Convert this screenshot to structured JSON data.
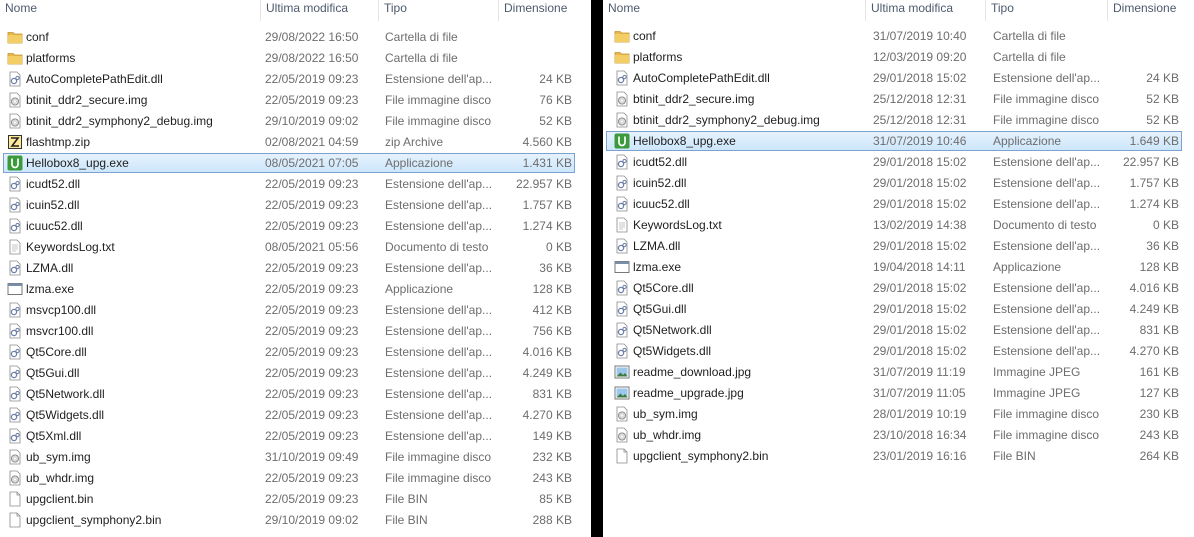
{
  "columns": {
    "name": "Nome",
    "modified": "Ultima modifica",
    "type": "Tipo",
    "size": "Dimensione"
  },
  "left_pane": {
    "files": [
      {
        "name": "conf",
        "modified": "29/08/2022 16:50",
        "type": "Cartella di file",
        "size": "",
        "icon": "folder-icon"
      },
      {
        "name": "platforms",
        "modified": "29/08/2022 16:50",
        "type": "Cartella di file",
        "size": "",
        "icon": "folder-icon"
      },
      {
        "name": "AutoCompletePathEdit.dll",
        "modified": "22/05/2019 09:23",
        "type": "Estensione dell'ap...",
        "size": "24 KB",
        "icon": "dll-icon"
      },
      {
        "name": "btinit_ddr2_secure.img",
        "modified": "22/05/2019 09:23",
        "type": "File immagine disco",
        "size": "76 KB",
        "icon": "disk-image-icon"
      },
      {
        "name": "btinit_ddr2_symphony2_debug.img",
        "modified": "29/10/2019 09:02",
        "type": "File immagine disco",
        "size": "52 KB",
        "icon": "disk-image-icon"
      },
      {
        "name": "flashtmp.zip",
        "modified": "02/08/2021 04:59",
        "type": "zip Archive",
        "size": "4.560 KB",
        "icon": "zip-icon"
      },
      {
        "name": "Hellobox8_upg.exe",
        "modified": "08/05/2021 07:05",
        "type": "Applicazione",
        "size": "1.431 KB",
        "icon": "hellobox-app-icon",
        "selected": true
      },
      {
        "name": "icudt52.dll",
        "modified": "22/05/2019 09:23",
        "type": "Estensione dell'ap...",
        "size": "22.957 KB",
        "icon": "dll-icon"
      },
      {
        "name": "icuin52.dll",
        "modified": "22/05/2019 09:23",
        "type": "Estensione dell'ap...",
        "size": "1.757 KB",
        "icon": "dll-icon"
      },
      {
        "name": "icuuc52.dll",
        "modified": "22/05/2019 09:23",
        "type": "Estensione dell'ap...",
        "size": "1.274 KB",
        "icon": "dll-icon"
      },
      {
        "name": "KeywordsLog.txt",
        "modified": "08/05/2021 05:56",
        "type": "Documento di testo",
        "size": "0 KB",
        "icon": "text-file-icon"
      },
      {
        "name": "LZMA.dll",
        "modified": "22/05/2019 09:23",
        "type": "Estensione dell'ap...",
        "size": "36 KB",
        "icon": "dll-icon"
      },
      {
        "name": "lzma.exe",
        "modified": "22/05/2019 09:23",
        "type": "Applicazione",
        "size": "128 KB",
        "icon": "exe-icon"
      },
      {
        "name": "msvcp100.dll",
        "modified": "22/05/2019 09:23",
        "type": "Estensione dell'ap...",
        "size": "412 KB",
        "icon": "dll-icon"
      },
      {
        "name": "msvcr100.dll",
        "modified": "22/05/2019 09:23",
        "type": "Estensione dell'ap...",
        "size": "756 KB",
        "icon": "dll-icon"
      },
      {
        "name": "Qt5Core.dll",
        "modified": "22/05/2019 09:23",
        "type": "Estensione dell'ap...",
        "size": "4.016 KB",
        "icon": "dll-icon"
      },
      {
        "name": "Qt5Gui.dll",
        "modified": "22/05/2019 09:23",
        "type": "Estensione dell'ap...",
        "size": "4.249 KB",
        "icon": "dll-icon"
      },
      {
        "name": "Qt5Network.dll",
        "modified": "22/05/2019 09:23",
        "type": "Estensione dell'ap...",
        "size": "831 KB",
        "icon": "dll-icon"
      },
      {
        "name": "Qt5Widgets.dll",
        "modified": "22/05/2019 09:23",
        "type": "Estensione dell'ap...",
        "size": "4.270 KB",
        "icon": "dll-icon"
      },
      {
        "name": "Qt5Xml.dll",
        "modified": "22/05/2019 09:23",
        "type": "Estensione dell'ap...",
        "size": "149 KB",
        "icon": "dll-icon"
      },
      {
        "name": "ub_sym.img",
        "modified": "31/10/2019 09:49",
        "type": "File immagine disco",
        "size": "232 KB",
        "icon": "disk-image-icon"
      },
      {
        "name": "ub_whdr.img",
        "modified": "22/05/2019 09:23",
        "type": "File immagine disco",
        "size": "243 KB",
        "icon": "disk-image-icon"
      },
      {
        "name": "upgclient.bin",
        "modified": "22/05/2019 09:23",
        "type": "File BIN",
        "size": "85 KB",
        "icon": "blank-file-icon"
      },
      {
        "name": "upgclient_symphony2.bin",
        "modified": "29/10/2019 09:02",
        "type": "File BIN",
        "size": "288 KB",
        "icon": "blank-file-icon"
      }
    ]
  },
  "right_pane": {
    "files": [
      {
        "name": "conf",
        "modified": "31/07/2019 10:40",
        "type": "Cartella di file",
        "size": "",
        "icon": "folder-icon"
      },
      {
        "name": "platforms",
        "modified": "12/03/2019 09:20",
        "type": "Cartella di file",
        "size": "",
        "icon": "folder-icon"
      },
      {
        "name": "AutoCompletePathEdit.dll",
        "modified": "29/01/2018 15:02",
        "type": "Estensione dell'ap...",
        "size": "24 KB",
        "icon": "dll-icon"
      },
      {
        "name": "btinit_ddr2_secure.img",
        "modified": "25/12/2018 12:31",
        "type": "File immagine disco",
        "size": "52 KB",
        "icon": "disk-image-icon"
      },
      {
        "name": "btinit_ddr2_symphony2_debug.img",
        "modified": "25/12/2018 12:31",
        "type": "File immagine disco",
        "size": "52 KB",
        "icon": "disk-image-icon"
      },
      {
        "name": "Hellobox8_upg.exe",
        "modified": "31/07/2019 10:46",
        "type": "Applicazione",
        "size": "1.649 KB",
        "icon": "hellobox-app-icon",
        "selected": true
      },
      {
        "name": "icudt52.dll",
        "modified": "29/01/2018 15:02",
        "type": "Estensione dell'ap...",
        "size": "22.957 KB",
        "icon": "dll-icon"
      },
      {
        "name": "icuin52.dll",
        "modified": "29/01/2018 15:02",
        "type": "Estensione dell'ap...",
        "size": "1.757 KB",
        "icon": "dll-icon"
      },
      {
        "name": "icuuc52.dll",
        "modified": "29/01/2018 15:02",
        "type": "Estensione dell'ap...",
        "size": "1.274 KB",
        "icon": "dll-icon"
      },
      {
        "name": "KeywordsLog.txt",
        "modified": "13/02/2019 14:38",
        "type": "Documento di testo",
        "size": "0 KB",
        "icon": "text-file-icon"
      },
      {
        "name": "LZMA.dll",
        "modified": "29/01/2018 15:02",
        "type": "Estensione dell'ap...",
        "size": "36 KB",
        "icon": "dll-icon"
      },
      {
        "name": "lzma.exe",
        "modified": "19/04/2018 14:11",
        "type": "Applicazione",
        "size": "128 KB",
        "icon": "exe-icon"
      },
      {
        "name": "Qt5Core.dll",
        "modified": "29/01/2018 15:02",
        "type": "Estensione dell'ap...",
        "size": "4.016 KB",
        "icon": "dll-icon"
      },
      {
        "name": "Qt5Gui.dll",
        "modified": "29/01/2018 15:02",
        "type": "Estensione dell'ap...",
        "size": "4.249 KB",
        "icon": "dll-icon"
      },
      {
        "name": "Qt5Network.dll",
        "modified": "29/01/2018 15:02",
        "type": "Estensione dell'ap...",
        "size": "831 KB",
        "icon": "dll-icon"
      },
      {
        "name": "Qt5Widgets.dll",
        "modified": "29/01/2018 15:02",
        "type": "Estensione dell'ap...",
        "size": "4.270 KB",
        "icon": "dll-icon"
      },
      {
        "name": "readme_download.jpg",
        "modified": "31/07/2019 11:19",
        "type": "Immagine JPEG",
        "size": "161 KB",
        "icon": "jpeg-image-icon"
      },
      {
        "name": "readme_upgrade.jpg",
        "modified": "31/07/2019 11:05",
        "type": "Immagine JPEG",
        "size": "127 KB",
        "icon": "jpeg-image-icon"
      },
      {
        "name": "ub_sym.img",
        "modified": "28/01/2019 10:19",
        "type": "File immagine disco",
        "size": "230 KB",
        "icon": "disk-image-icon"
      },
      {
        "name": "ub_whdr.img",
        "modified": "23/10/2018 16:34",
        "type": "File immagine disco",
        "size": "243 KB",
        "icon": "disk-image-icon"
      },
      {
        "name": "upgclient_symphony2.bin",
        "modified": "23/01/2019 16:16",
        "type": "File BIN",
        "size": "264 KB",
        "icon": "blank-file-icon"
      }
    ]
  },
  "colors": {
    "selection_bg": "#cde6fb",
    "selection_border": "#7da2ce",
    "header_text": "#4d5a6e",
    "meta_text": "#6d6d6d",
    "name_text": "#1e1e1e",
    "folder_yellow": "#e8b84a",
    "app_green": "#3c9a3c"
  }
}
